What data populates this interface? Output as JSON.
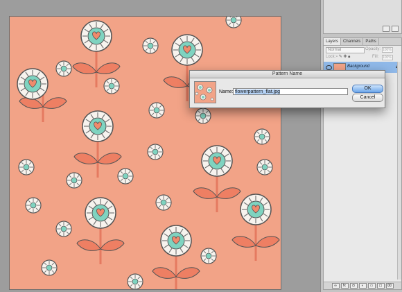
{
  "dialog": {
    "title": "Pattern Name",
    "name_label": "Name:",
    "name_value": "flowerpattern_flat.jpg",
    "ok_label": "OK",
    "cancel_label": "Cancel"
  },
  "layers_panel": {
    "tabs": [
      "Layers",
      "Channels",
      "Paths"
    ],
    "blend_mode": "Normal",
    "opacity_label": "Opacity:",
    "opacity_value": "100%",
    "lock_label": "Lock:",
    "fill_label": "Fill:",
    "fill_value": "100%",
    "layer_name": "Background"
  },
  "colors": {
    "canvas": "#f2a387",
    "workspace": "#9d9d9d",
    "selected_layer": "#8fb8e8",
    "petal": "#f7f3ee",
    "center": "#7fd3c0",
    "heart": "#f08a6c",
    "leaf": "#ee7f63"
  },
  "icons": [
    "eye-icon",
    "lock-icon",
    "link-icon",
    "fx-icon",
    "mask-icon",
    "adjustment-icon",
    "folder-icon",
    "new-layer-icon",
    "trash-icon"
  ]
}
